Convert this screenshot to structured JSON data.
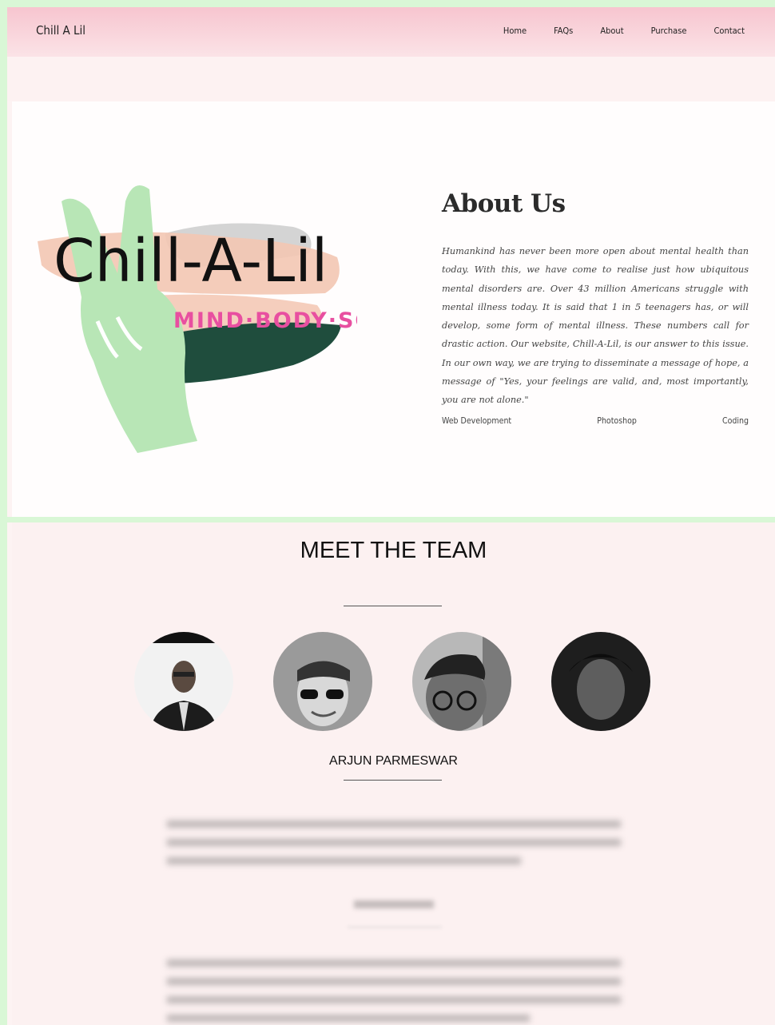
{
  "nav": {
    "brand": "Chill A Lil",
    "links": [
      "Home",
      "FAQs",
      "About",
      "Purchase",
      "Contact"
    ]
  },
  "about": {
    "logo_text": "Chill-A-Lil",
    "logo_tagline": "MIND·BODY·SOU",
    "title": "About Us",
    "body": "Humankind has never been more open about mental health than today. With this, we have come to realise just how ubiquitous mental disorders are. Over 43 million Americans struggle with mental illness today. It is said that 1 in 5 teenagers has, or will develop, some form of mental illness. These numbers call for drastic action. Our website, Chill-A-Lil, is our answer to this issue. In our own way, we are trying to disseminate a message of hope, a message of \"Yes, your feelings are valid, and, most importantly, you are not alone.\"",
    "skills": [
      "Web Development",
      "Photoshop",
      "Coding"
    ]
  },
  "team": {
    "title": "MEET THE TEAM",
    "member_name": "ARJUN PARMESWAR"
  },
  "colors": {
    "nav_pink": "#f7c5cf",
    "border_green": "#d9f7d6",
    "logo_green": "#b8e6b6",
    "logo_pink": "#e84fa0"
  }
}
